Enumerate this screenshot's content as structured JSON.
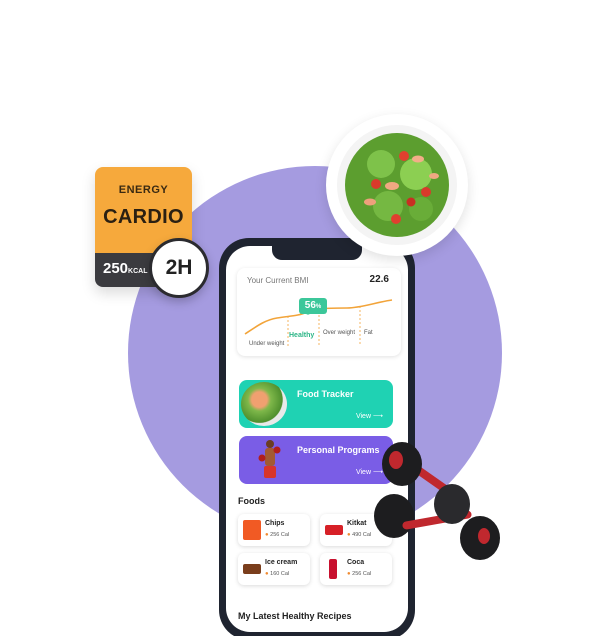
{
  "energy_card": {
    "label": "ENERGY",
    "title": "CARDIO",
    "calories": "250",
    "calories_unit": "KCAL",
    "duration": "2H"
  },
  "bmi": {
    "title": "Your Current BMI",
    "value": "22.6",
    "percent": "56",
    "percent_unit": "%",
    "labels": {
      "under": "Under weight",
      "healthy": "Healthy",
      "over": "Over weight",
      "fat": "Fat"
    }
  },
  "food_tracker": {
    "title": "Food Tracker",
    "view_label": "View",
    "arrow_icon": "arrow-right-icon"
  },
  "personal_programs": {
    "title": "Personal Programs",
    "view_label": "View",
    "arrow_icon": "arrow-right-icon"
  },
  "foods": {
    "title": "Foods",
    "items": [
      {
        "name": "Chips",
        "calories": "256 Cal"
      },
      {
        "name": "Kitkat",
        "calories": "490 Cal"
      },
      {
        "name": "Ice cream",
        "calories": "160 Cal"
      },
      {
        "name": "Coca",
        "calories": "256 Cal"
      }
    ]
  },
  "recipes": {
    "title": "My Latest Healthy Recipes"
  },
  "colors": {
    "blob": "#a59be0",
    "energy": "#f6a93c",
    "food_tracker": "#1fd2b3",
    "personal_programs": "#7a5de6",
    "bmi_line": "#f2a43a",
    "healthy": "#3cc79a"
  }
}
